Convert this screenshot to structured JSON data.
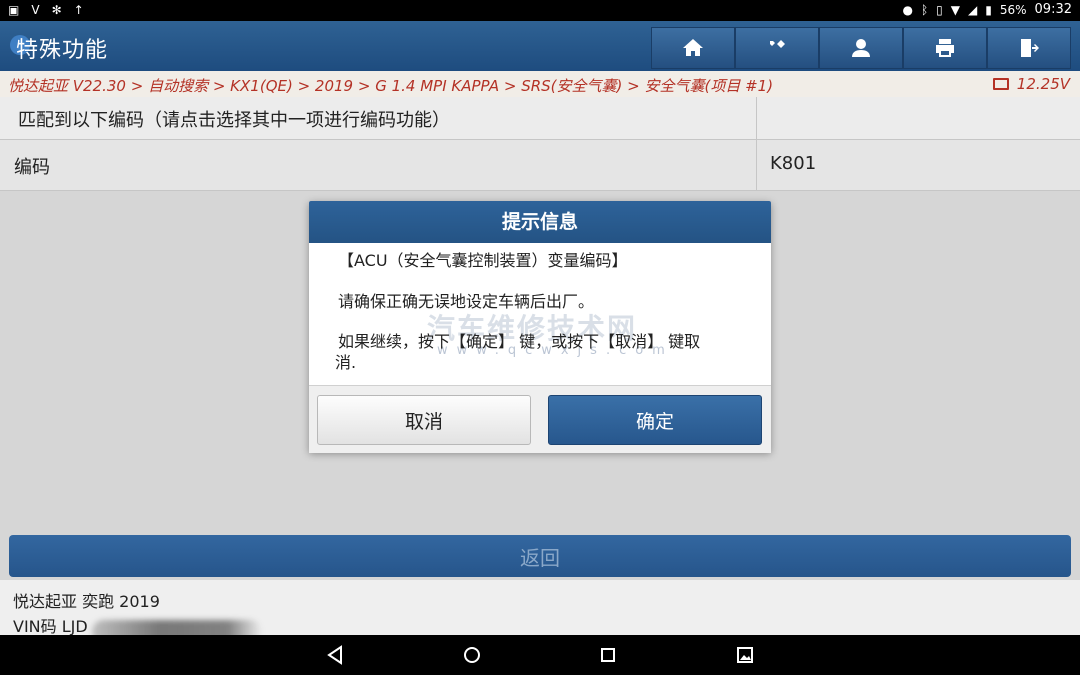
{
  "status": {
    "battery": "56%",
    "time": "09:32"
  },
  "app": {
    "title": "特殊功能"
  },
  "breadcrumb": "悦达起亚 V22.30 > 自动搜索 > KX1(QE) > 2019 > G 1.4 MPI KAPPA > SRS(安全气囊) > 安全气囊(项目 #1)",
  "voltage": "12.25V",
  "table": {
    "header": "匹配到以下编码（请点击选择其中一项进行编码功能）",
    "row_label": "编码",
    "row_value": "K801"
  },
  "dialog": {
    "title": "提示信息",
    "line1": "【ACU（安全气囊控制装置）变量编码】",
    "line2": "请确保正确无误地设定车辆后出厂。",
    "line3": "如果继续，按下【确定】 键，或按下【取消】 键取",
    "line4": "消.",
    "watermark": "汽车维修技术网",
    "watermark_url": "www.qcwxjs.com",
    "cancel": "取消",
    "ok": "确定"
  },
  "back_button": "返回",
  "vehicle": {
    "name": "悦达起亚 奕跑 2019",
    "vin_label": "VIN码 LJD"
  },
  "icons": {
    "toolbar": [
      "home-icon",
      "tools-icon",
      "user-icon",
      "print-icon",
      "exit-icon"
    ],
    "nav": [
      "back-icon",
      "home-nav-icon",
      "recents-icon",
      "screenshot-icon"
    ]
  }
}
